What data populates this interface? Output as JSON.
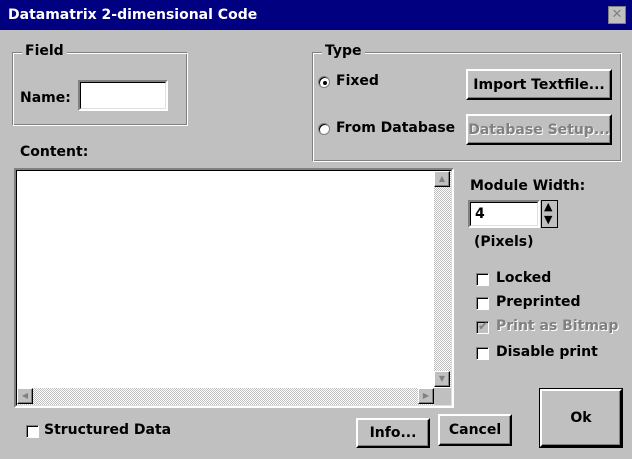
{
  "window": {
    "title": "Datamatrix 2-dimensional Code",
    "close_glyph": "✕"
  },
  "field": {
    "legend": "Field",
    "name_label": "Name:",
    "name_value": ""
  },
  "type": {
    "legend": "Type",
    "fixed_label": "Fixed",
    "from_database_label": "From Database",
    "selected": "Fixed",
    "import_button": "Import Textfile...",
    "database_setup_button": "Database Setup..."
  },
  "content": {
    "label": "Content:",
    "value": ""
  },
  "module_width": {
    "label": "Module Width:",
    "value": "4",
    "unit": "(Pixels)"
  },
  "options": {
    "locked": "Locked",
    "preprinted": "Preprinted",
    "print_as_bitmap": "Print as Bitmap",
    "disable_print": "Disable print"
  },
  "structured_data_label": "Structured Data",
  "buttons": {
    "info": "Info...",
    "cancel": "Cancel",
    "ok": "Ok"
  },
  "icons": {
    "scroll_up": "▲",
    "scroll_down": "▼",
    "scroll_left": "◀",
    "scroll_right": "▶",
    "spin_up": "▲",
    "spin_down": "▼",
    "check": "✔"
  }
}
